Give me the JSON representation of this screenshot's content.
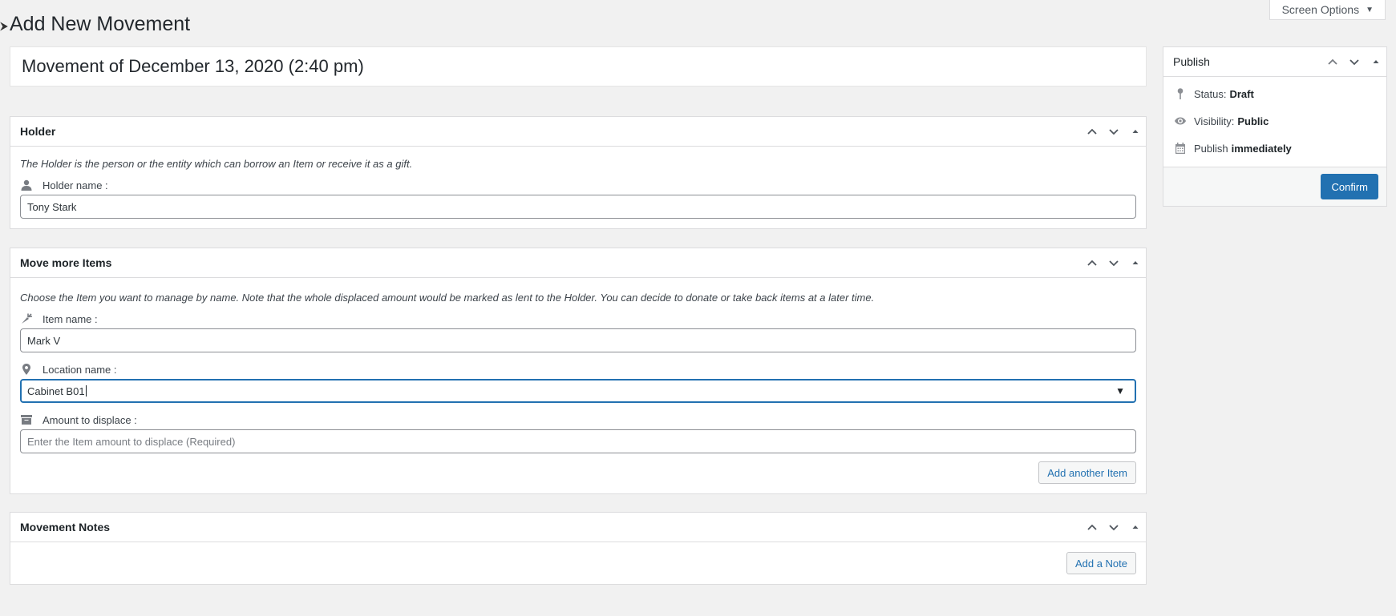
{
  "page": {
    "title": "Add New Movement",
    "screen_options_label": "Screen Options"
  },
  "post": {
    "title": "Movement of December 13, 2020 (2:40 pm)"
  },
  "holder_box": {
    "heading": "Holder",
    "description": "The Holder is the person or the entity which can borrow an Item or receive it as a gift.",
    "holder_label": "Holder name :",
    "holder_value": "Tony Stark"
  },
  "items_box": {
    "heading": "Move more Items",
    "description": "Choose the Item you want to manage by name. Note that the whole displaced amount would be marked as lent to the Holder. You can decide to donate or take back items at a later time.",
    "item_label": "Item name :",
    "item_value": "Mark V",
    "location_label": "Location name :",
    "location_value": "Cabinet B01",
    "amount_label": "Amount to displace :",
    "amount_placeholder": "Enter the Item amount to displace (Required)",
    "add_item_label": "Add another Item"
  },
  "notes_box": {
    "heading": "Movement Notes",
    "add_note_label": "Add a Note"
  },
  "publish_box": {
    "heading": "Publish",
    "status_label": "Status:",
    "status_value": "Draft",
    "visibility_label": "Visibility:",
    "visibility_value": "Public",
    "publish_label": "Publish",
    "publish_value": "immediately",
    "confirm_label": "Confirm"
  }
}
